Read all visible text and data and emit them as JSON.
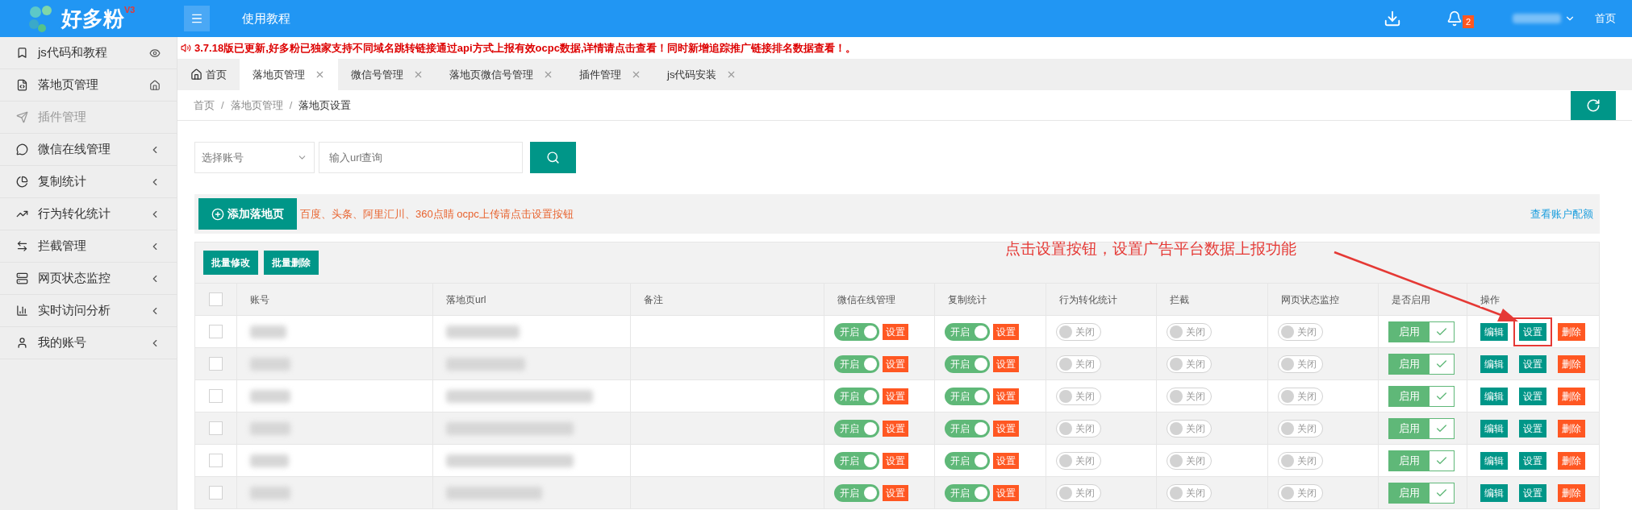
{
  "header": {
    "logo": "好多粉",
    "version": "V3",
    "tutorial": "使用教程",
    "notifications": "2",
    "home_link": "首页"
  },
  "sidebar": {
    "items": [
      {
        "label": "js代码和教程",
        "kind": "eye",
        "disabled": false
      },
      {
        "label": "落地页管理",
        "kind": "home",
        "disabled": false
      },
      {
        "label": "插件管理",
        "kind": "plain",
        "disabled": true
      },
      {
        "label": "微信在线管理",
        "kind": "submenu",
        "disabled": false
      },
      {
        "label": "复制统计",
        "kind": "submenu",
        "disabled": false
      },
      {
        "label": "行为转化统计",
        "kind": "submenu",
        "disabled": false
      },
      {
        "label": "拦截管理",
        "kind": "submenu",
        "disabled": false
      },
      {
        "label": "网页状态监控",
        "kind": "submenu",
        "disabled": false
      },
      {
        "label": "实时访问分析",
        "kind": "submenu",
        "disabled": false
      },
      {
        "label": "我的账号",
        "kind": "submenu",
        "disabled": false
      }
    ]
  },
  "notice": "3.7.18版已更新,好多粉已独家支持不同域名跳转链接通过api方式上报有效ocpc数据,详情请点击查看！同时新增追踪推广链接排名数据查看！。",
  "tabs": [
    {
      "label": "首页",
      "kind": "home",
      "selected": false
    },
    {
      "label": "落地页管理",
      "kind": "closable",
      "selected": true
    },
    {
      "label": "微信号管理",
      "kind": "closable",
      "selected": false
    },
    {
      "label": "落地页微信号管理",
      "kind": "closable",
      "selected": false
    },
    {
      "label": "插件管理",
      "kind": "closable",
      "selected": false
    },
    {
      "label": "js代码安装",
      "kind": "closable",
      "selected": false
    }
  ],
  "breadcrumb": [
    "首页",
    "落地页管理",
    "落地页设置"
  ],
  "breadcrumb_separator": "/",
  "search": {
    "account_select": "选择账号",
    "url_placeholder": "输入url查询"
  },
  "add_button": "添加落地页",
  "hint": "百度、头条、阿里汇川、360点睛 ocpc上传请点击设置按钮",
  "quota_link": "查看账户配额",
  "batch_buttons": [
    "批量修改",
    "批量删除"
  ],
  "annotation": "点击设置按钮，设置广告平台数据上报功能",
  "table": {
    "all_checked": false,
    "columns": [
      "账号",
      "落地页url",
      "备注",
      "微信在线管理",
      "复制统计",
      "行为转化统计",
      "拦截",
      "网页状态监控",
      "是否启用",
      "操作"
    ],
    "rows": [
      {
        "checked": false,
        "switches": [
          {
            "on": true,
            "label": "开启",
            "button": "设置"
          },
          {
            "on": true,
            "label": "开启",
            "button": "设置"
          },
          {
            "on": false,
            "label": "关闭"
          },
          {
            "on": false,
            "label": "关闭"
          },
          {
            "on": false,
            "label": "关闭"
          }
        ],
        "enabled": {
          "label": "启用",
          "checked": true
        },
        "actions": [
          {
            "label": "编辑",
            "kind": "edit",
            "highlighted": false
          },
          {
            "label": "设置",
            "kind": "settings",
            "highlighted": true
          },
          {
            "label": "删除",
            "kind": "delete",
            "highlighted": false
          }
        ]
      },
      {
        "checked": false,
        "switches": [
          {
            "on": true,
            "label": "开启",
            "button": "设置"
          },
          {
            "on": true,
            "label": "开启",
            "button": "设置"
          },
          {
            "on": false,
            "label": "关闭"
          },
          {
            "on": false,
            "label": "关闭"
          },
          {
            "on": false,
            "label": "关闭"
          }
        ],
        "enabled": {
          "label": "启用",
          "checked": true
        },
        "actions": [
          {
            "label": "编辑",
            "kind": "edit",
            "highlighted": false
          },
          {
            "label": "设置",
            "kind": "settings",
            "highlighted": false
          },
          {
            "label": "删除",
            "kind": "delete",
            "highlighted": false
          }
        ]
      },
      {
        "checked": false,
        "switches": [
          {
            "on": true,
            "label": "开启",
            "button": "设置"
          },
          {
            "on": true,
            "label": "开启",
            "button": "设置"
          },
          {
            "on": false,
            "label": "关闭"
          },
          {
            "on": false,
            "label": "关闭"
          },
          {
            "on": false,
            "label": "关闭"
          }
        ],
        "enabled": {
          "label": "启用",
          "checked": true
        },
        "actions": [
          {
            "label": "编辑",
            "kind": "edit",
            "highlighted": false
          },
          {
            "label": "设置",
            "kind": "settings",
            "highlighted": false
          },
          {
            "label": "删除",
            "kind": "delete",
            "highlighted": false
          }
        ]
      },
      {
        "checked": false,
        "switches": [
          {
            "on": true,
            "label": "开启",
            "button": "设置"
          },
          {
            "on": true,
            "label": "开启",
            "button": "设置"
          },
          {
            "on": false,
            "label": "关闭"
          },
          {
            "on": false,
            "label": "关闭"
          },
          {
            "on": false,
            "label": "关闭"
          }
        ],
        "enabled": {
          "label": "启用",
          "checked": true
        },
        "actions": [
          {
            "label": "编辑",
            "kind": "edit",
            "highlighted": false
          },
          {
            "label": "设置",
            "kind": "settings",
            "highlighted": false
          },
          {
            "label": "删除",
            "kind": "delete",
            "highlighted": false
          }
        ]
      },
      {
        "checked": false,
        "switches": [
          {
            "on": true,
            "label": "开启",
            "button": "设置"
          },
          {
            "on": true,
            "label": "开启",
            "button": "设置"
          },
          {
            "on": false,
            "label": "关闭"
          },
          {
            "on": false,
            "label": "关闭"
          },
          {
            "on": false,
            "label": "关闭"
          }
        ],
        "enabled": {
          "label": "启用",
          "checked": true
        },
        "actions": [
          {
            "label": "编辑",
            "kind": "edit",
            "highlighted": false
          },
          {
            "label": "设置",
            "kind": "settings",
            "highlighted": false
          },
          {
            "label": "删除",
            "kind": "delete",
            "highlighted": false
          }
        ]
      },
      {
        "checked": false,
        "switches": [
          {
            "on": true,
            "label": "开启",
            "button": "设置"
          },
          {
            "on": true,
            "label": "开启",
            "button": "设置"
          },
          {
            "on": false,
            "label": "关闭"
          },
          {
            "on": false,
            "label": "关闭"
          },
          {
            "on": false,
            "label": "关闭"
          }
        ],
        "enabled": {
          "label": "启用",
          "checked": true
        },
        "actions": [
          {
            "label": "编辑",
            "kind": "edit",
            "highlighted": false
          },
          {
            "label": "设置",
            "kind": "settings",
            "highlighted": false
          },
          {
            "label": "删除",
            "kind": "delete",
            "highlighted": false
          }
        ]
      }
    ]
  }
}
